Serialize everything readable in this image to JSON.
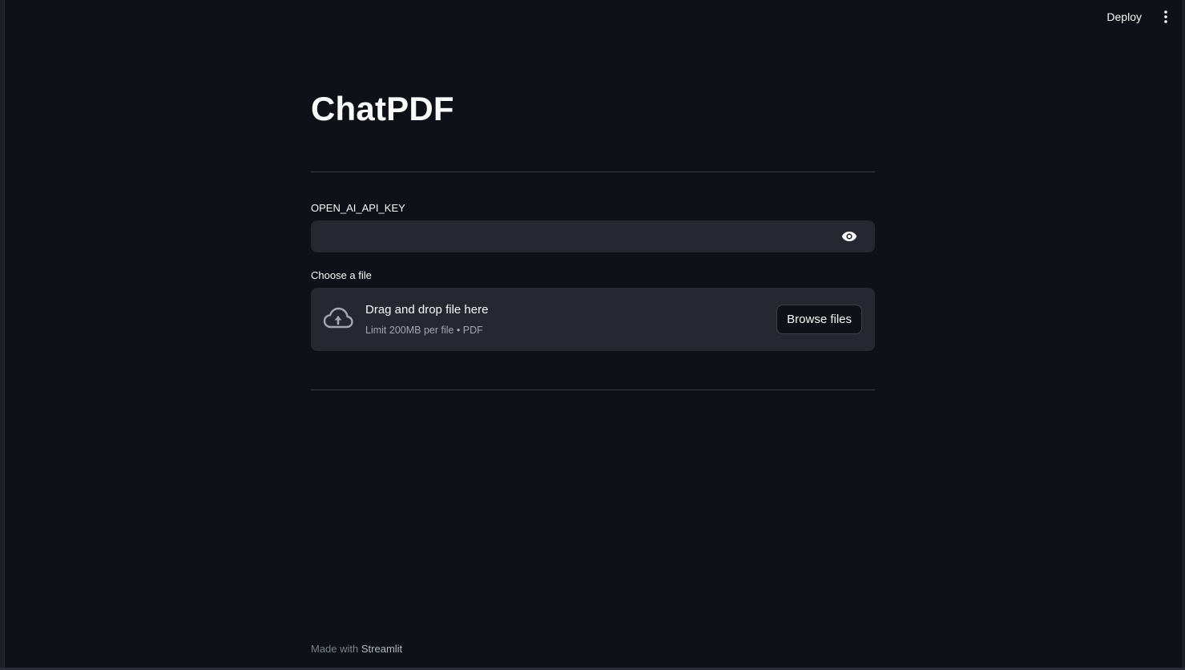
{
  "toolbar": {
    "deploy_label": "Deploy",
    "menu_icon": "kebab-vertical-icon"
  },
  "page": {
    "title": "ChatPDF"
  },
  "api_key": {
    "label": "OPEN_AI_API_KEY",
    "value": "",
    "placeholder": "",
    "toggle_icon": "eye-icon"
  },
  "file_upload": {
    "label": "Choose a file",
    "drop_title": "Drag and drop file here",
    "limit_text": "Limit 200MB per file • PDF",
    "browse_label": "Browse files",
    "icon": "cloud-upload-icon"
  },
  "footer": {
    "prefix": "Made with",
    "brand": "Streamlit"
  },
  "colors": {
    "background": "#0e1117",
    "widget_bg": "#262730",
    "text": "#fafafa",
    "muted": "#a3a8b4"
  }
}
